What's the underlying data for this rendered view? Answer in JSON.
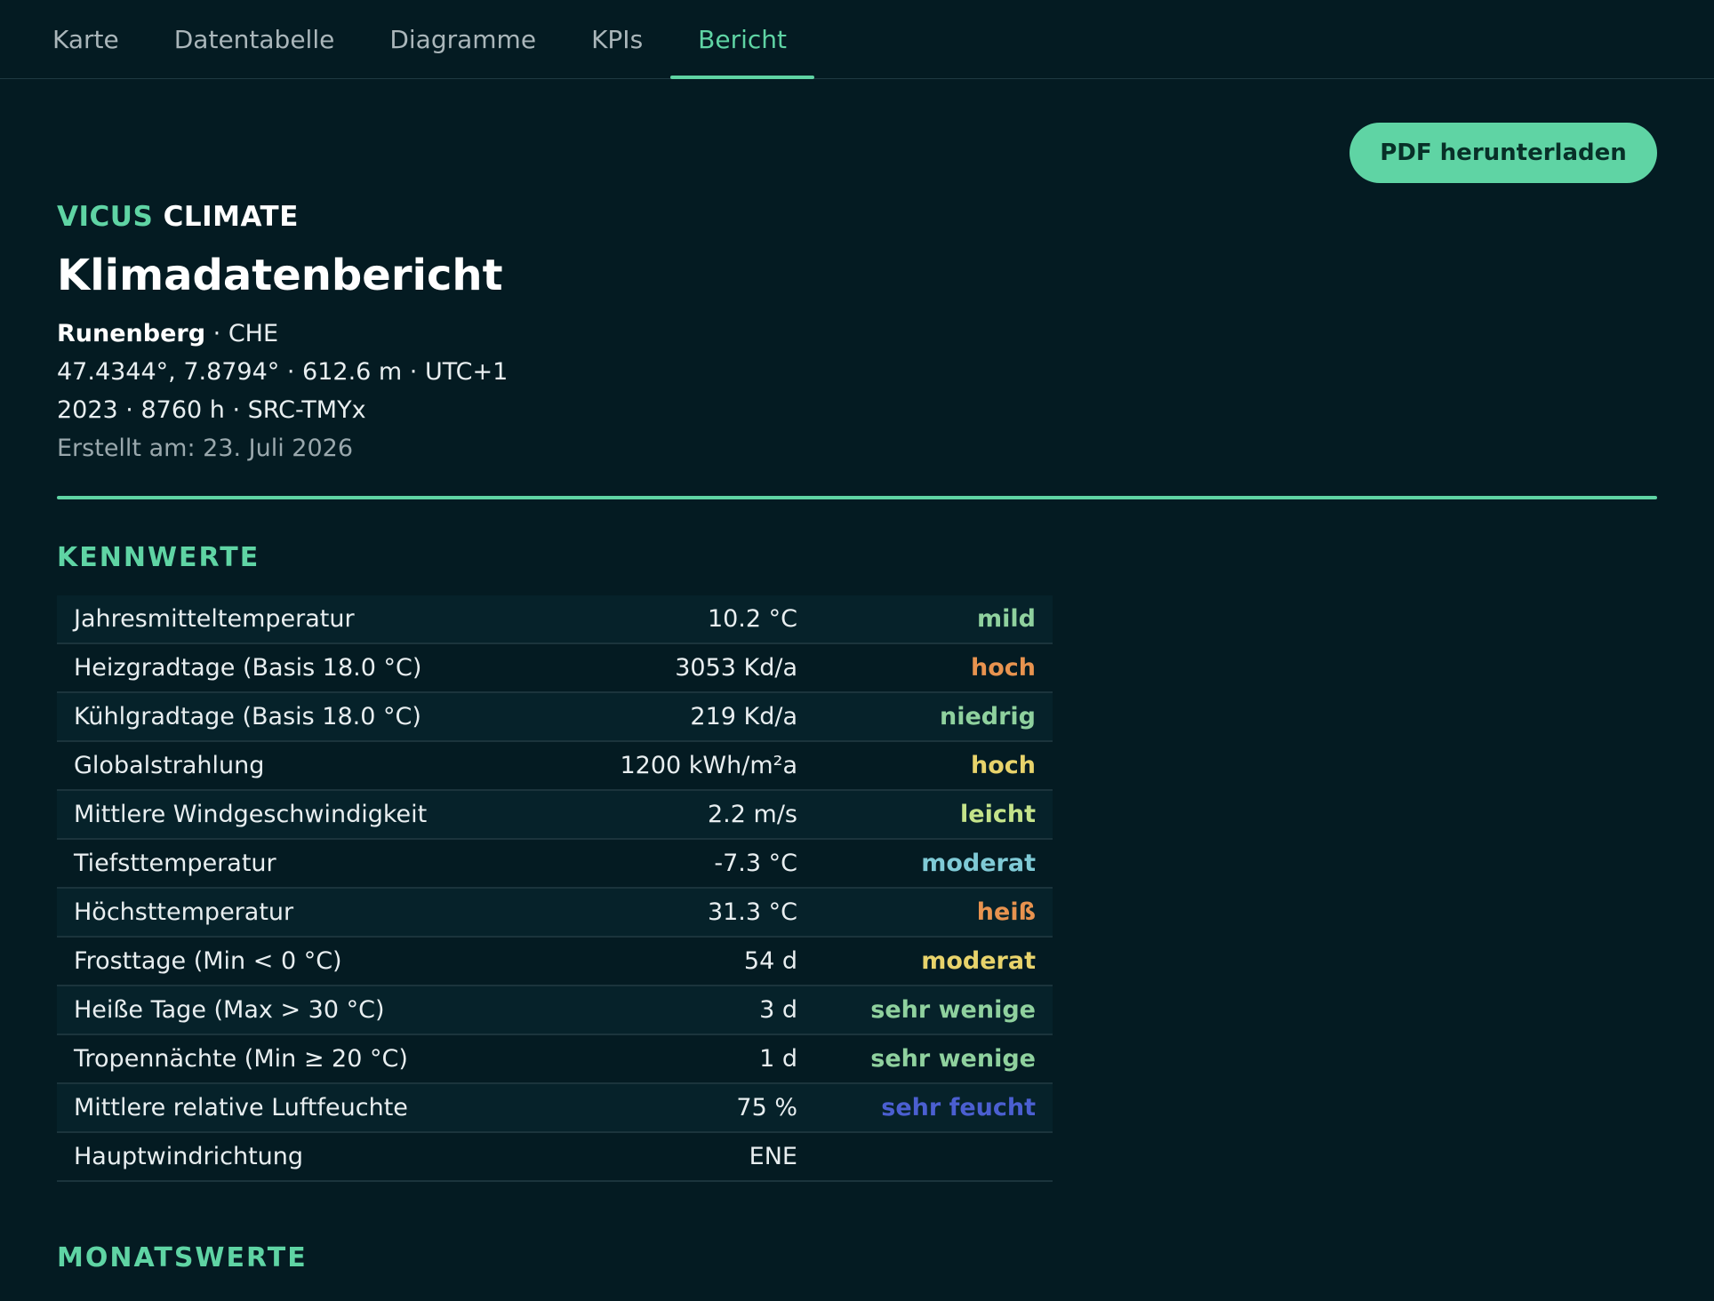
{
  "tabs": [
    {
      "label": "Karte",
      "active": false
    },
    {
      "label": "Datentabelle",
      "active": false
    },
    {
      "label": "Diagramme",
      "active": false
    },
    {
      "label": "KPIs",
      "active": false
    },
    {
      "label": "Bericht",
      "active": true
    }
  ],
  "toolbar": {
    "pdf_label": "PDF herunterladen"
  },
  "header": {
    "brand_accent": "VICUS",
    "brand_rest": "CLIMATE",
    "title": "Klimadatenbericht",
    "location_name": "Runenberg",
    "location_country": "· CHE",
    "coordinates_line": "47.4344°, 7.8794° · 612.6 m · UTC+1",
    "dataset_line": "2023 · 8760 h · SRC-TMYx",
    "created_line": "Erstellt am: 23. Juli 2026"
  },
  "sections": {
    "kennwerte": "KENNWERTE",
    "monatswerte": "MONATSWERTE"
  },
  "colors": {
    "accent": "#5fd4a4",
    "background": "#041b22",
    "rating_green": "#8fd19e",
    "rating_orange": "#e8934f",
    "rating_yellow": "#e8d36b",
    "rating_lightgreen": "#c4e38a",
    "rating_cyan": "#7fcad6",
    "rating_blue": "#4b5fd1"
  },
  "kennwerte": [
    {
      "label": "Jahresmitteltemperatur",
      "value": "10.2 °C",
      "rating": "mild",
      "color": "#8fd19e"
    },
    {
      "label": "Heizgradtage (Basis 18.0 °C)",
      "value": "3053 Kd/a",
      "rating": "hoch",
      "color": "#e8934f"
    },
    {
      "label": "Kühlgradtage (Basis 18.0 °C)",
      "value": "219 Kd/a",
      "rating": "niedrig",
      "color": "#8fd19e"
    },
    {
      "label": "Globalstrahlung",
      "value": "1200 kWh/m²a",
      "rating": "hoch",
      "color": "#e8d36b"
    },
    {
      "label": "Mittlere Windgeschwindigkeit",
      "value": "2.2 m/s",
      "rating": "leicht",
      "color": "#c4e38a"
    },
    {
      "label": "Tiefsttemperatur",
      "value": "-7.3 °C",
      "rating": "moderat",
      "color": "#7fcad6"
    },
    {
      "label": "Höchsttemperatur",
      "value": "31.3 °C",
      "rating": "heiß",
      "color": "#e8934f"
    },
    {
      "label": "Frosttage (Min < 0 °C)",
      "value": "54 d",
      "rating": "moderat",
      "color": "#e8d36b"
    },
    {
      "label": "Heiße Tage (Max > 30 °C)",
      "value": "3 d",
      "rating": "sehr wenige",
      "color": "#8fd19e"
    },
    {
      "label": "Tropennächte (Min ≥ 20 °C)",
      "value": "1 d",
      "rating": "sehr wenige",
      "color": "#8fd19e"
    },
    {
      "label": "Mittlere relative Luftfeuchte",
      "value": "75 %",
      "rating": "sehr feucht",
      "color": "#4b5fd1"
    },
    {
      "label": "Hauptwindrichtung",
      "value": "ENE",
      "rating": "",
      "color": "#8fd19e"
    }
  ]
}
